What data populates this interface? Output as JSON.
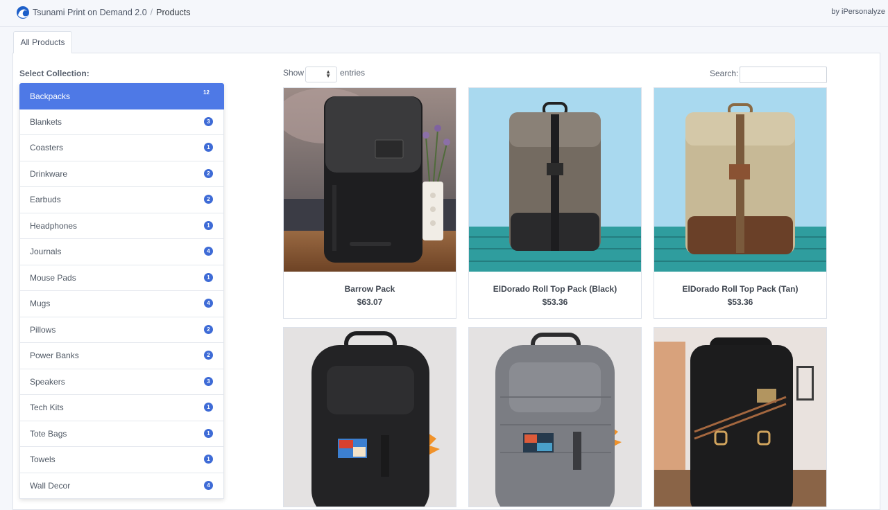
{
  "header": {
    "app_name": "Tsunami Print on Demand 2.0",
    "separator": "/",
    "current_page": "Products",
    "by_line": "by iPersonalyze"
  },
  "tabs": [
    {
      "label": "All Products",
      "active": true
    }
  ],
  "sidebar": {
    "label": "Select Collection:",
    "items": [
      {
        "label": "Backpacks",
        "count": "12",
        "active": true
      },
      {
        "label": "Blankets",
        "count": "3"
      },
      {
        "label": "Coasters",
        "count": "1"
      },
      {
        "label": "Drinkware",
        "count": "2"
      },
      {
        "label": "Earbuds",
        "count": "2"
      },
      {
        "label": "Headphones",
        "count": "1"
      },
      {
        "label": "Journals",
        "count": "4"
      },
      {
        "label": "Mouse Pads",
        "count": "1"
      },
      {
        "label": "Mugs",
        "count": "4"
      },
      {
        "label": "Pillows",
        "count": "2"
      },
      {
        "label": "Power Banks",
        "count": "2"
      },
      {
        "label": "Speakers",
        "count": "3"
      },
      {
        "label": "Tech Kits",
        "count": "1"
      },
      {
        "label": "Tote Bags",
        "count": "1"
      },
      {
        "label": "Towels",
        "count": "1"
      },
      {
        "label": "Wall Decor",
        "count": "4"
      }
    ]
  },
  "table_controls": {
    "show_label": "Show",
    "entries_label": "entries",
    "search_label": "Search:",
    "search_value": ""
  },
  "products": [
    {
      "name": "Barrow Pack",
      "price": "$63.07"
    },
    {
      "name": "ElDorado Roll Top Pack (Black)",
      "price": "$53.36"
    },
    {
      "name": "ElDorado Roll Top Pack (Tan)",
      "price": "$53.36"
    },
    {
      "name": "",
      "price": ""
    },
    {
      "name": "",
      "price": ""
    },
    {
      "name": "",
      "price": ""
    }
  ],
  "colors": {
    "accent": "#4e79e6",
    "badge": "#3e6bd6",
    "page_bg": "#f5f7fb"
  }
}
